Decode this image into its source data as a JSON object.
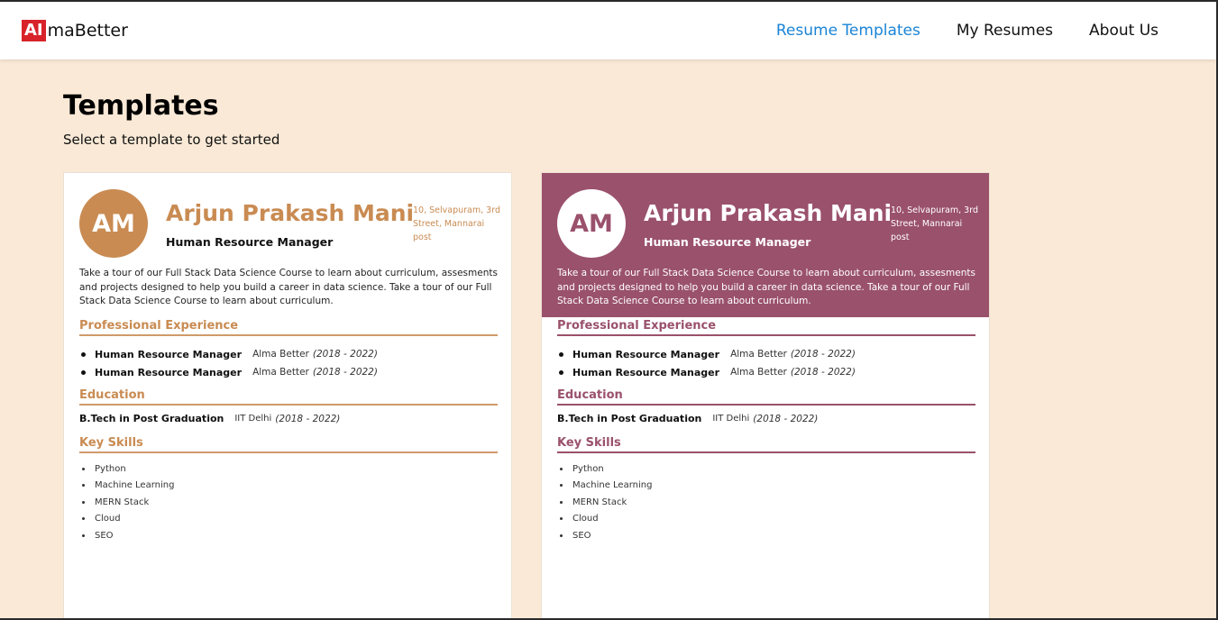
{
  "navbar": {
    "logo_box": "AI",
    "logo_text": "maBetter",
    "links": [
      {
        "label": "Resume Templates",
        "active": true
      },
      {
        "label": "My Resumes",
        "active": false
      },
      {
        "label": "About Us",
        "active": false
      }
    ]
  },
  "page": {
    "title": "Templates",
    "subtitle": "Select a template to get started"
  },
  "colors": {
    "accent_link": "#1a84d6",
    "template1_accent": "#c98b52",
    "template2_accent": "#9a516c",
    "background": "#f9e9d6",
    "logo_red": "#d8232a"
  },
  "templates": [
    {
      "initials": "AM",
      "name": "Arjun Prakash Mani",
      "role": "Human Resource Manager",
      "address": "10, Selvapuram, 3rd Street, Mannarai post",
      "summary": "Take a tour of our Full Stack Data Science Course to learn about curriculum, assesments and projects designed to help you build a career in data science. Take a tour of our Full Stack Data Science Course to learn about curriculum.",
      "experience_title": "Professional Experience",
      "experience": [
        {
          "role": "Human Resource Manager",
          "org": "Alma Better",
          "years": "(2018 - 2022)"
        },
        {
          "role": "Human Resource Manager",
          "org": "Alma Better",
          "years": "(2018 - 2022)"
        }
      ],
      "education_title": "Education",
      "education": {
        "degree": "B.Tech in Post Graduation",
        "institute": "IIT Delhi",
        "years": "(2018 - 2022)"
      },
      "skills_title": "Key Skills",
      "skills": [
        "Python",
        "Machine Learning",
        "MERN Stack",
        "Cloud",
        "SEO"
      ]
    },
    {
      "initials": "AM",
      "name": "Arjun Prakash Mani",
      "role": "Human Resource Manager",
      "address": "10, Selvapuram, 3rd Street, Mannarai post",
      "summary": "Take a tour of our Full Stack Data Science Course to learn about curriculum, assesments and projects designed to help you build a career in data science. Take a tour of our Full Stack Data Science Course to learn about curriculum.",
      "experience_title": "Professional Experience",
      "experience": [
        {
          "role": "Human Resource Manager",
          "org": "Alma Better",
          "years": "(2018 - 2022)"
        },
        {
          "role": "Human Resource Manager",
          "org": "Alma Better",
          "years": "(2018 - 2022)"
        }
      ],
      "education_title": "Education",
      "education": {
        "degree": "B.Tech in Post Graduation",
        "institute": "IIT Delhi",
        "years": "(2018 - 2022)"
      },
      "skills_title": "Key Skills",
      "skills": [
        "Python",
        "Machine Learning",
        "MERN Stack",
        "Cloud",
        "SEO"
      ]
    }
  ]
}
